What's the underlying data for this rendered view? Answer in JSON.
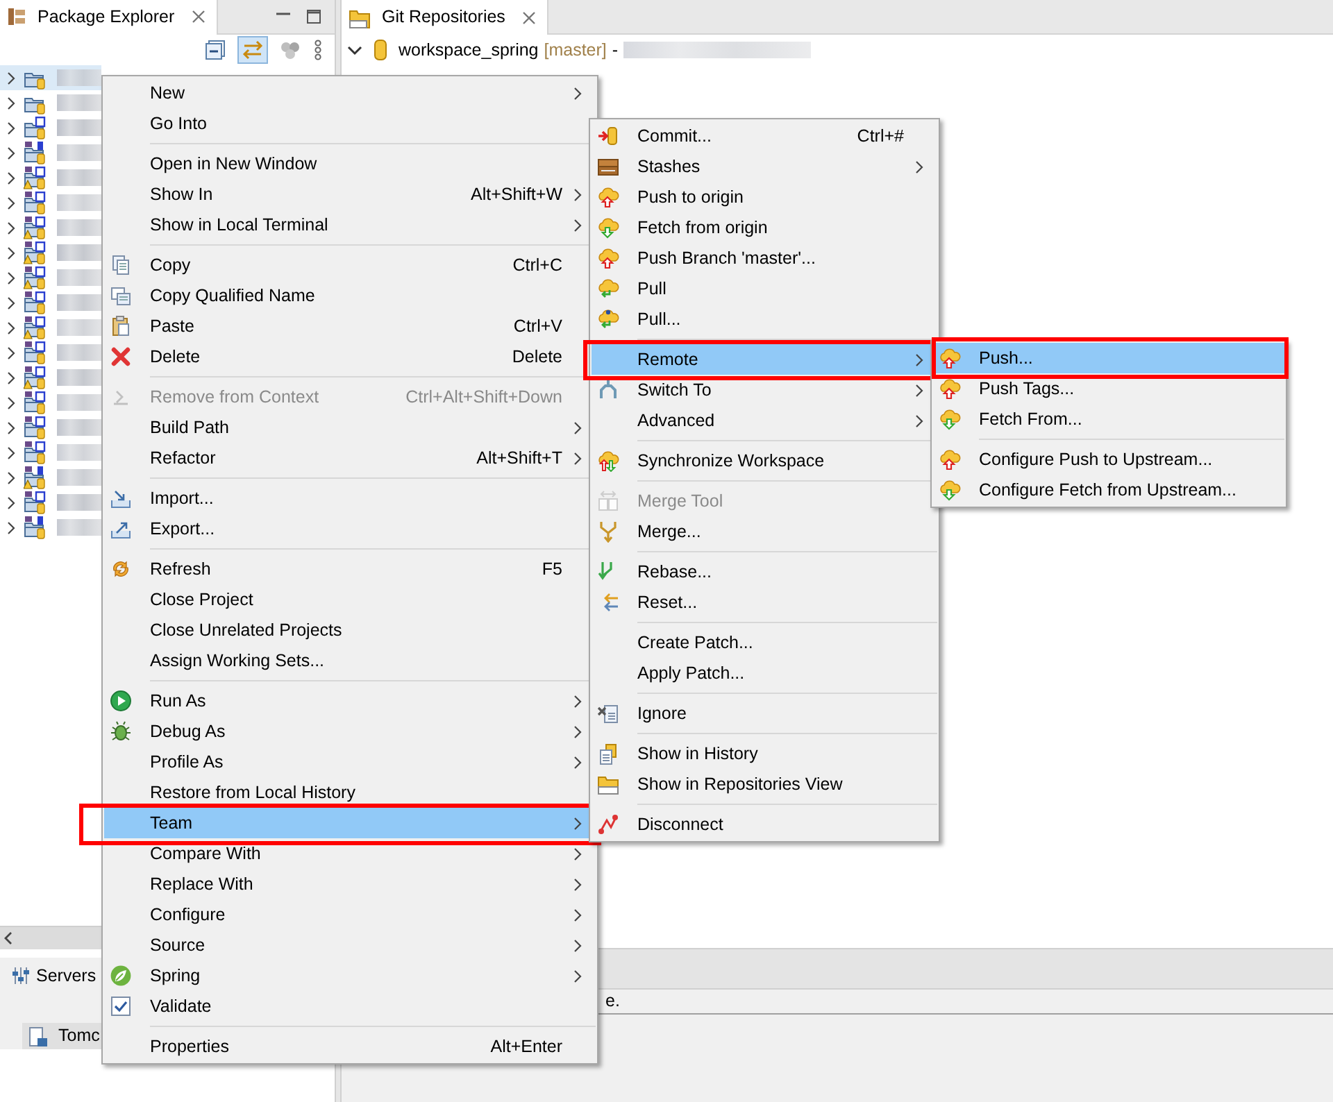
{
  "package_explorer": {
    "title": "Package Explorer",
    "projects": [
      {
        "kind": "plain",
        "warning": false,
        "selected": true
      },
      {
        "kind": "plain",
        "warning": false,
        "selected": false
      },
      {
        "kind": "spring",
        "warning": false,
        "selected": false
      },
      {
        "kind": "maven-java",
        "warning": false,
        "selected": false
      },
      {
        "kind": "maven-spring",
        "warning": true,
        "selected": false
      },
      {
        "kind": "maven-spring",
        "warning": false,
        "selected": false
      },
      {
        "kind": "maven-spring",
        "warning": true,
        "selected": false
      },
      {
        "kind": "maven-spring",
        "warning": true,
        "selected": false
      },
      {
        "kind": "maven-spring",
        "warning": true,
        "selected": false
      },
      {
        "kind": "maven-spring",
        "warning": false,
        "selected": false
      },
      {
        "kind": "maven-spring",
        "warning": true,
        "selected": false
      },
      {
        "kind": "maven-spring",
        "warning": false,
        "selected": false
      },
      {
        "kind": "maven-spring",
        "warning": true,
        "selected": false
      },
      {
        "kind": "maven-spring",
        "warning": false,
        "selected": false
      },
      {
        "kind": "maven-spring",
        "warning": false,
        "selected": false
      },
      {
        "kind": "maven-spring",
        "warning": false,
        "selected": false
      },
      {
        "kind": "maven-java",
        "warning": true,
        "selected": false
      },
      {
        "kind": "maven-spring",
        "warning": false,
        "selected": false
      },
      {
        "kind": "maven-java",
        "warning": false,
        "selected": false
      }
    ]
  },
  "servers": {
    "title": "Servers",
    "items": [
      "Tomc"
    ]
  },
  "git_repositories": {
    "title": "Git Repositories",
    "repository": {
      "name": "workspace_spring",
      "branch": "[master]",
      "separator": "-"
    }
  },
  "bottom_panel": {
    "text": "e."
  },
  "context_menu": [
    {
      "kind": "text",
      "label": "New",
      "submenu": true,
      "disabled": false,
      "selected": false,
      "outlined": false
    },
    {
      "kind": "text",
      "label": "Go Into",
      "submenu": false,
      "disabled": false,
      "selected": false,
      "outlined": false
    },
    {
      "kind": "separator"
    },
    {
      "kind": "text",
      "label": "Open in New Window",
      "submenu": false,
      "disabled": false,
      "selected": false,
      "outlined": false
    },
    {
      "kind": "text",
      "label": "Show In",
      "shortcut": "Alt+Shift+W",
      "submenu": true,
      "disabled": false,
      "selected": false,
      "outlined": false
    },
    {
      "kind": "text",
      "label": "Show in Local Terminal",
      "submenu": true,
      "disabled": false,
      "selected": false,
      "outlined": false
    },
    {
      "kind": "separator"
    },
    {
      "kind": "copy",
      "label": "Copy",
      "shortcut": "Ctrl+C",
      "submenu": false,
      "disabled": false,
      "selected": false,
      "outlined": false
    },
    {
      "kind": "copyname",
      "label": "Copy Qualified Name",
      "submenu": false,
      "disabled": false,
      "selected": false,
      "outlined": false
    },
    {
      "kind": "paste",
      "label": "Paste",
      "shortcut": "Ctrl+V",
      "submenu": false,
      "disabled": false,
      "selected": false,
      "outlined": false
    },
    {
      "kind": "delete",
      "label": "Delete",
      "shortcut": "Delete",
      "submenu": false,
      "disabled": false,
      "selected": false,
      "outlined": false
    },
    {
      "kind": "separator"
    },
    {
      "kind": "remove",
      "label": "Remove from Context",
      "shortcut": "Ctrl+Alt+Shift+Down",
      "submenu": false,
      "disabled": true,
      "selected": false,
      "outlined": false
    },
    {
      "kind": "text",
      "label": "Build Path",
      "submenu": true,
      "disabled": false,
      "selected": false,
      "outlined": false
    },
    {
      "kind": "text",
      "label": "Refactor",
      "shortcut": "Alt+Shift+T",
      "submenu": true,
      "disabled": false,
      "selected": false,
      "outlined": false
    },
    {
      "kind": "separator"
    },
    {
      "kind": "import",
      "label": "Import...",
      "submenu": false,
      "disabled": false,
      "selected": false,
      "outlined": false
    },
    {
      "kind": "export",
      "label": "Export...",
      "submenu": false,
      "disabled": false,
      "selected": false,
      "outlined": false
    },
    {
      "kind": "separator"
    },
    {
      "kind": "refresh",
      "label": "Refresh",
      "shortcut": "F5",
      "submenu": false,
      "disabled": false,
      "selected": false,
      "outlined": false
    },
    {
      "kind": "text",
      "label": "Close Project",
      "submenu": false,
      "disabled": false,
      "selected": false,
      "outlined": false
    },
    {
      "kind": "text",
      "label": "Close Unrelated Projects",
      "submenu": false,
      "disabled": false,
      "selected": false,
      "outlined": false
    },
    {
      "kind": "text",
      "label": "Assign Working Sets...",
      "submenu": false,
      "disabled": false,
      "selected": false,
      "outlined": false
    },
    {
      "kind": "separator"
    },
    {
      "kind": "run",
      "label": "Run As",
      "submenu": true,
      "disabled": false,
      "selected": false,
      "outlined": false
    },
    {
      "kind": "debug",
      "label": "Debug As",
      "submenu": true,
      "disabled": false,
      "selected": false,
      "outlined": false
    },
    {
      "kind": "text",
      "label": "Profile As",
      "submenu": true,
      "disabled": false,
      "selected": false,
      "outlined": false
    },
    {
      "kind": "text",
      "label": "Restore from Local History",
      "submenu": false,
      "disabled": false,
      "selected": false,
      "outlined": false
    },
    {
      "kind": "text",
      "label": "Team",
      "submenu": true,
      "disabled": false,
      "selected": true,
      "outlined": true
    },
    {
      "kind": "text",
      "label": "Compare With",
      "submenu": true,
      "disabled": false,
      "selected": false,
      "outlined": false
    },
    {
      "kind": "text",
      "label": "Replace With",
      "submenu": true,
      "disabled": false,
      "selected": false,
      "outlined": false
    },
    {
      "kind": "text",
      "label": "Configure",
      "submenu": true,
      "disabled": false,
      "selected": false,
      "outlined": false
    },
    {
      "kind": "text",
      "label": "Source",
      "submenu": true,
      "disabled": false,
      "selected": false,
      "outlined": false
    },
    {
      "kind": "spring",
      "label": "Spring",
      "submenu": true,
      "disabled": false,
      "selected": false,
      "outlined": false
    },
    {
      "kind": "validate",
      "label": "Validate",
      "submenu": false,
      "disabled": false,
      "selected": false,
      "outlined": false
    },
    {
      "kind": "separator"
    },
    {
      "kind": "text",
      "label": "Properties",
      "shortcut": "Alt+Enter",
      "submenu": false,
      "disabled": false,
      "selected": false,
      "outlined": false
    }
  ],
  "team_menu": [
    {
      "kind": "commit",
      "label": "Commit...",
      "shortcut": "Ctrl+#",
      "submenu": false,
      "disabled": false,
      "selected": false,
      "outlined": false
    },
    {
      "kind": "stash",
      "label": "Stashes",
      "submenu": true,
      "disabled": false,
      "selected": false,
      "outlined": false
    },
    {
      "kind": "push",
      "label": "Push to origin",
      "submenu": false,
      "disabled": false,
      "selected": false,
      "outlined": false
    },
    {
      "kind": "fetch",
      "label": "Fetch from origin",
      "submenu": false,
      "disabled": false,
      "selected": false,
      "outlined": false
    },
    {
      "kind": "push",
      "label": "Push Branch 'master'...",
      "submenu": false,
      "disabled": false,
      "selected": false,
      "outlined": false
    },
    {
      "kind": "pull",
      "label": "Pull",
      "submenu": false,
      "disabled": false,
      "selected": false,
      "outlined": false
    },
    {
      "kind": "pulldialog",
      "label": "Pull...",
      "submenu": false,
      "disabled": false,
      "selected": false,
      "outlined": false
    },
    {
      "kind": "separator"
    },
    {
      "kind": "text",
      "label": "Remote",
      "submenu": true,
      "disabled": false,
      "selected": true,
      "outlined": true
    },
    {
      "kind": "switch",
      "label": "Switch To",
      "submenu": true,
      "disabled": false,
      "selected": false,
      "outlined": false
    },
    {
      "kind": "text",
      "label": "Advanced",
      "submenu": true,
      "disabled": false,
      "selected": false,
      "outlined": false
    },
    {
      "kind": "separator"
    },
    {
      "kind": "sync",
      "label": "Synchronize Workspace",
      "submenu": false,
      "disabled": false,
      "selected": false,
      "outlined": false
    },
    {
      "kind": "separator"
    },
    {
      "kind": "mergetool",
      "label": "Merge Tool",
      "submenu": false,
      "disabled": true,
      "selected": false,
      "outlined": false
    },
    {
      "kind": "merge",
      "label": "Merge...",
      "submenu": false,
      "disabled": false,
      "selected": false,
      "outlined": false
    },
    {
      "kind": "separator"
    },
    {
      "kind": "rebase",
      "label": "Rebase...",
      "submenu": false,
      "disabled": false,
      "selected": false,
      "outlined": false
    },
    {
      "kind": "reset",
      "label": "Reset...",
      "submenu": false,
      "disabled": false,
      "selected": false,
      "outlined": false
    },
    {
      "kind": "separator"
    },
    {
      "kind": "text",
      "label": "Create Patch...",
      "submenu": false,
      "disabled": false,
      "selected": false,
      "outlined": false
    },
    {
      "kind": "text",
      "label": "Apply Patch...",
      "submenu": false,
      "disabled": false,
      "selected": false,
      "outlined": false
    },
    {
      "kind": "separator"
    },
    {
      "kind": "ignore",
      "label": "Ignore",
      "submenu": false,
      "disabled": false,
      "selected": false,
      "outlined": false
    },
    {
      "kind": "separator"
    },
    {
      "kind": "history",
      "label": "Show in History",
      "submenu": false,
      "disabled": false,
      "selected": false,
      "outlined": false
    },
    {
      "kind": "repo",
      "label": "Show in Repositories View",
      "submenu": false,
      "disabled": false,
      "selected": false,
      "outlined": false
    },
    {
      "kind": "separator"
    },
    {
      "kind": "disconnect",
      "label": "Disconnect",
      "submenu": false,
      "disabled": false,
      "selected": false,
      "outlined": false
    }
  ],
  "remote_menu": [
    {
      "kind": "push",
      "label": "Push...",
      "submenu": false,
      "disabled": false,
      "selected": true,
      "outlined": true
    },
    {
      "kind": "push",
      "label": "Push Tags...",
      "submenu": false,
      "disabled": false,
      "selected": false,
      "outlined": false
    },
    {
      "kind": "fetch",
      "label": "Fetch From...",
      "submenu": false,
      "disabled": false,
      "selected": false,
      "outlined": false
    },
    {
      "kind": "separator"
    },
    {
      "kind": "push",
      "label": "Configure Push to Upstream...",
      "submenu": false,
      "disabled": false,
      "selected": false,
      "outlined": false
    },
    {
      "kind": "fetch",
      "label": "Configure Fetch from Upstream...",
      "submenu": false,
      "disabled": false,
      "selected": false,
      "outlined": false
    }
  ]
}
